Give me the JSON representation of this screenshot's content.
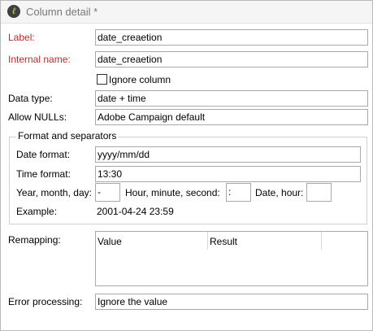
{
  "window": {
    "title": "Column detail *"
  },
  "form": {
    "label": {
      "label": "Label:",
      "value": "date_creaetion"
    },
    "internal_name": {
      "label": "Internal name:",
      "value": "date_creaetion"
    },
    "ignore_column": {
      "label": "Ignore column",
      "checked": false
    },
    "data_type": {
      "label": "Data type:",
      "value": "date + time"
    },
    "allow_nulls": {
      "label": "Allow NULLs:",
      "value": "Adobe Campaign default"
    }
  },
  "format": {
    "title": "Format and separators",
    "date_format": {
      "label": "Date format:",
      "value": "yyyy/mm/dd"
    },
    "time_format": {
      "label": "Time format:",
      "value": "13:30"
    },
    "ymd_sep": {
      "label": "Year, month, day:",
      "value": "-"
    },
    "hms_sep": {
      "label": "Hour, minute, second:",
      "value": ":"
    },
    "date_hour_sep": {
      "label": "Date, hour:",
      "value": ""
    },
    "example": {
      "label": "Example:",
      "value": "2001-04-24 23:59"
    }
  },
  "remapping": {
    "label": "Remapping:",
    "columns": [
      "Value",
      "Result"
    ]
  },
  "error_processing": {
    "label": "Error processing:",
    "value": "Ignore the value"
  }
}
